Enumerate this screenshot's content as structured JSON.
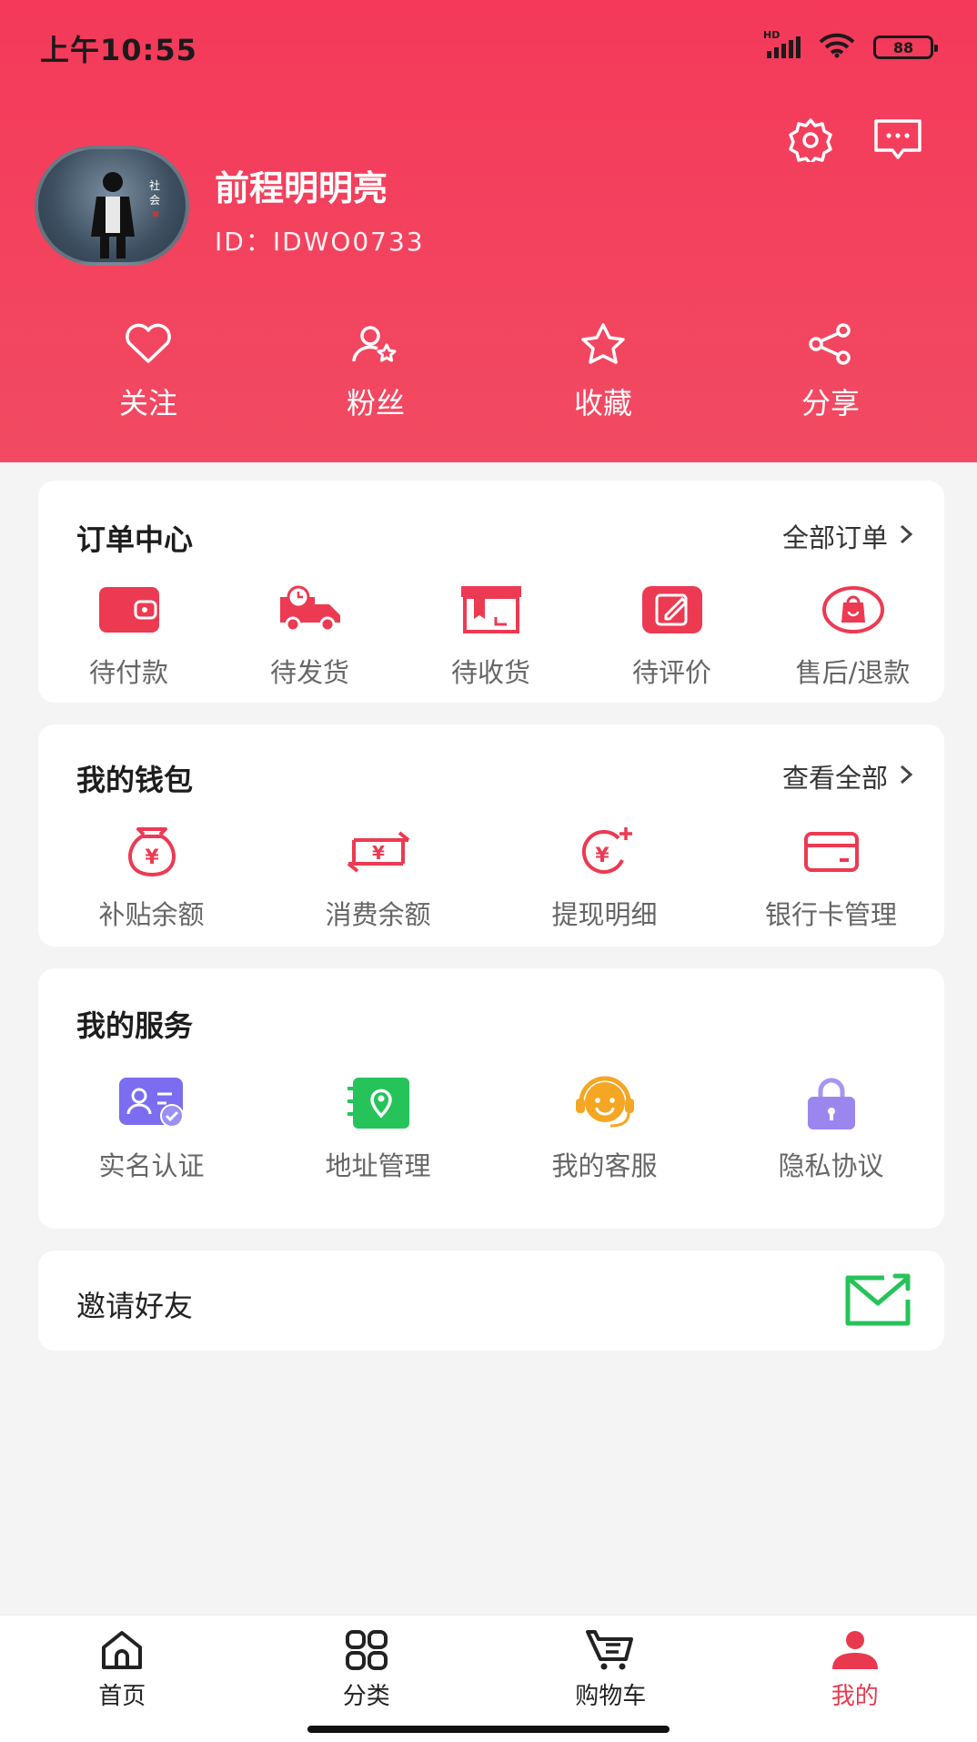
{
  "status_bar": {
    "time": "上午10:55",
    "network": "HD",
    "battery": "88"
  },
  "profile": {
    "name": "前程明明亮",
    "id": "ID：IDWO0733"
  },
  "quick_actions": [
    {
      "label": "关注",
      "icon": "heart-icon"
    },
    {
      "label": "粉丝",
      "icon": "fans-icon"
    },
    {
      "label": "收藏",
      "icon": "star-icon"
    },
    {
      "label": "分享",
      "icon": "share-icon"
    }
  ],
  "orders": {
    "title": "订单中心",
    "more": "全部订单",
    "items": [
      {
        "label": "待付款",
        "icon": "wallet-icon"
      },
      {
        "label": "待发货",
        "icon": "truck-icon"
      },
      {
        "label": "待收货",
        "icon": "package-icon"
      },
      {
        "label": "待评价",
        "icon": "edit-icon"
      },
      {
        "label": "售后/退款",
        "icon": "refund-bag-icon"
      }
    ]
  },
  "wallet": {
    "title": "我的钱包",
    "more": "查看全部",
    "items": [
      {
        "label": "补贴余额",
        "icon": "money-bag-icon"
      },
      {
        "label": "消费余额",
        "icon": "exchange-icon"
      },
      {
        "label": "提现明细",
        "icon": "withdraw-icon"
      },
      {
        "label": "银行卡管理",
        "icon": "bank-card-icon"
      }
    ]
  },
  "services": {
    "title": "我的服务",
    "items": [
      {
        "label": "实名认证",
        "icon": "id-verify-icon"
      },
      {
        "label": "地址管理",
        "icon": "address-icon"
      },
      {
        "label": "我的客服",
        "icon": "customer-service-icon"
      },
      {
        "label": "隐私协议",
        "icon": "lock-icon"
      }
    ]
  },
  "invite": {
    "label": "邀请好友",
    "icon": "invite-mail-icon"
  },
  "tabbar": [
    {
      "label": "首页",
      "icon": "home-icon",
      "active": false
    },
    {
      "label": "分类",
      "icon": "category-icon",
      "active": false
    },
    {
      "label": "购物车",
      "icon": "cart-icon",
      "active": false
    },
    {
      "label": "我的",
      "icon": "profile-icon",
      "active": true
    }
  ],
  "colors": {
    "brand": "#f4395a",
    "accent_red": "#e8394f",
    "green": "#26c35a",
    "purple": "#7b6cf0",
    "orange": "#f5a623"
  }
}
